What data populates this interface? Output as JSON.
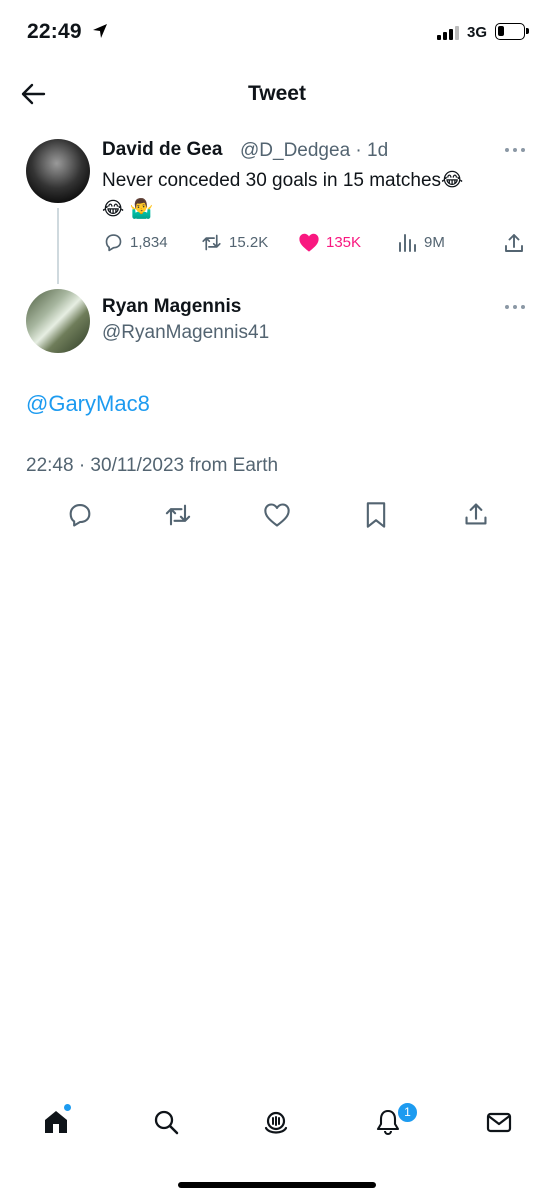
{
  "status_bar": {
    "time": "22:49",
    "network": "3G"
  },
  "header": {
    "title": "Tweet",
    "back_icon": "arrow-left-icon"
  },
  "parent_tweet": {
    "author_name": "David de Gea",
    "handle_and_time": "@D_Dedgea · 1d",
    "text": "Never conceded 30 goals in 15 matches😂",
    "emoji_line": "😂 🤷‍♂️",
    "actions": {
      "replies": "1,834",
      "retweets": "15.2K",
      "likes": "135K",
      "views": "9M"
    },
    "like_color": "#f91880"
  },
  "reply": {
    "author_name": "Ryan Magennis",
    "handle": "@RyanMagennis41",
    "text": "@GaryMac8",
    "timestamp": "22:48 · 30/11/2023 from Earth"
  },
  "bottom_nav": {
    "items": [
      "home-icon",
      "search-icon",
      "spaces-icon",
      "notifications-icon",
      "messages-icon"
    ],
    "notifications_badge": "1"
  },
  "colors": {
    "accent": "#1d9bf0",
    "muted": "#536471",
    "text": "#0f1419"
  }
}
